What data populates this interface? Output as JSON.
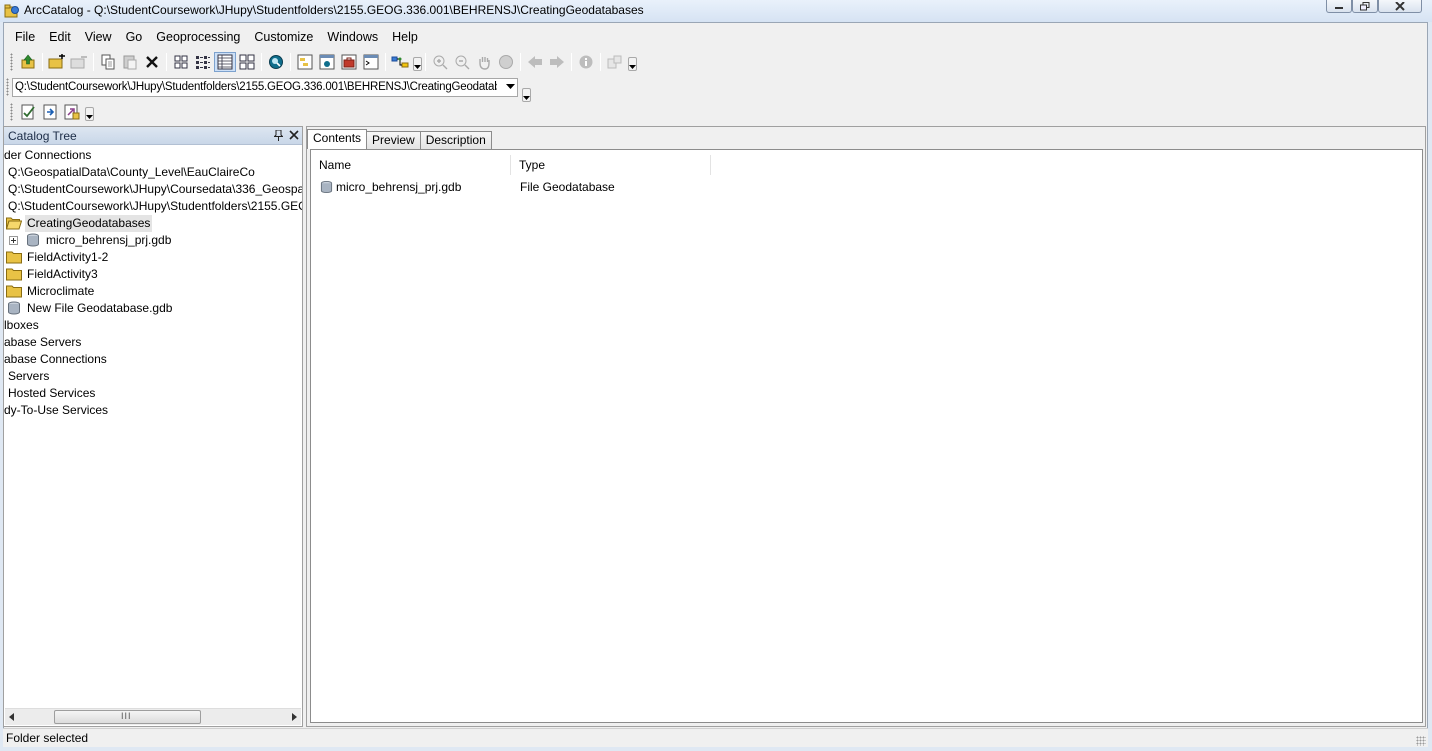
{
  "window": {
    "title": "ArcCatalog - Q:\\StudentCoursework\\JHupy\\Studentfolders\\2155.GEOG.336.001\\BEHRENSJ\\CreatingGeodatabases"
  },
  "menu": [
    "File",
    "Edit",
    "View",
    "Go",
    "Geoprocessing",
    "Customize",
    "Windows",
    "Help"
  ],
  "location": {
    "value": "Q:\\StudentCoursework\\JHupy\\Studentfolders\\2155.GEOG.336.001\\BEHRENSJ\\CreatingGeodatabases"
  },
  "catalog_tree": {
    "header": "Catalog Tree",
    "items": [
      {
        "label": "der Connections",
        "icon": "none"
      },
      {
        "label": "Q:\\GeospatialData\\County_Level\\EauClaireCo",
        "icon": "none"
      },
      {
        "label": "Q:\\StudentCoursework\\JHupy\\Coursedata\\336_Geospat",
        "icon": "none"
      },
      {
        "label": "Q:\\StudentCoursework\\JHupy\\Studentfolders\\2155.GEC",
        "icon": "none"
      },
      {
        "label": "CreatingGeodatabases",
        "icon": "open-folder-icon"
      },
      {
        "label": "micro_behrensj_prj.gdb",
        "icon": "geodatabase-icon"
      },
      {
        "label": "FieldActivity1-2",
        "icon": "folder-icon"
      },
      {
        "label": "FieldActivity3",
        "icon": "folder-icon"
      },
      {
        "label": "Microclimate",
        "icon": "folder-icon"
      },
      {
        "label": "New File Geodatabase.gdb",
        "icon": "geodatabase-icon"
      },
      {
        "label": "lboxes",
        "icon": "none"
      },
      {
        "label": "abase Servers",
        "icon": "none"
      },
      {
        "label": "abase Connections",
        "icon": "none"
      },
      {
        "label": "Servers",
        "icon": "none"
      },
      {
        "label": "Hosted Services",
        "icon": "none"
      },
      {
        "label": "dy-To-Use Services",
        "icon": "none"
      }
    ]
  },
  "tabs": [
    {
      "label": "Contents",
      "active": true
    },
    {
      "label": "Preview",
      "active": false
    },
    {
      "label": "Description",
      "active": false
    }
  ],
  "contents": {
    "columns": [
      "Name",
      "Type"
    ],
    "rows": [
      {
        "name": "micro_behrensj_prj.gdb",
        "type": "File Geodatabase"
      }
    ]
  },
  "status": {
    "text": "Folder selected"
  },
  "colors": {
    "panel_header": "#c9d7e8",
    "selection": "#e4e4e4",
    "folder": "#e8c245"
  }
}
